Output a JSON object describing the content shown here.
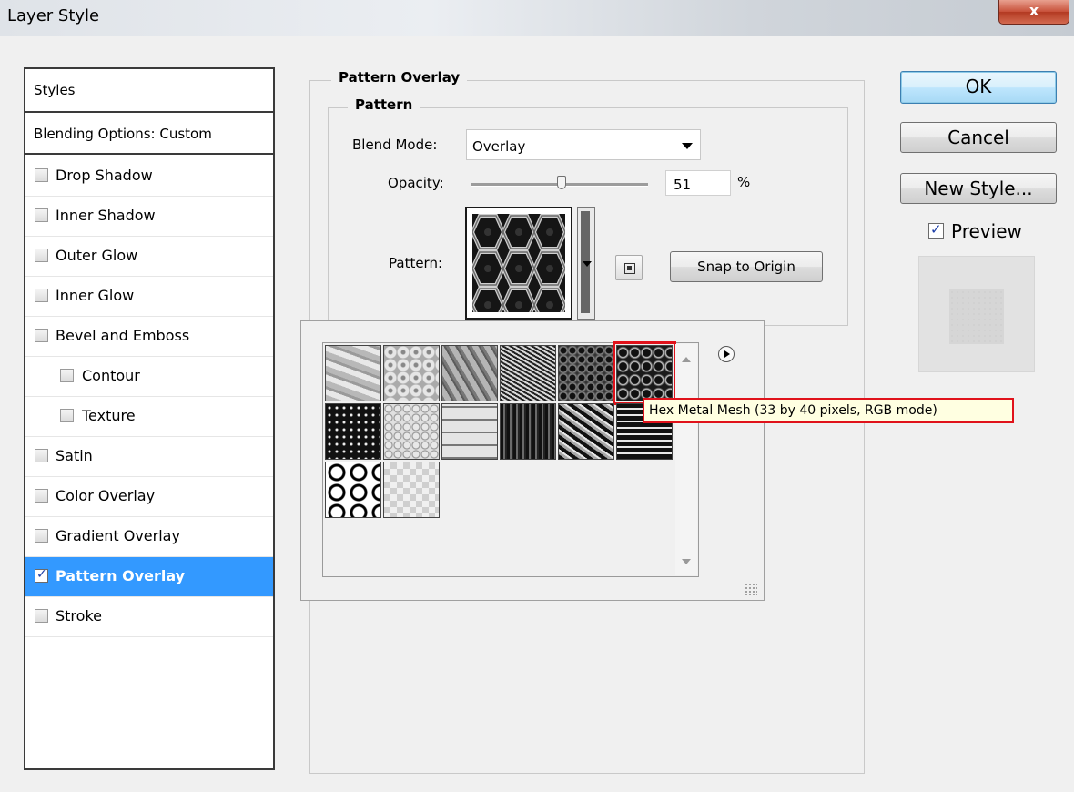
{
  "window": {
    "title": "Layer Style",
    "close_label": "x"
  },
  "styles_panel": {
    "header": "Styles",
    "blending_options": "Blending Options: Custom",
    "items": [
      {
        "label": "Drop Shadow",
        "checked": false,
        "indent": false,
        "selected": false
      },
      {
        "label": "Inner Shadow",
        "checked": false,
        "indent": false,
        "selected": false
      },
      {
        "label": "Outer Glow",
        "checked": false,
        "indent": false,
        "selected": false
      },
      {
        "label": "Inner Glow",
        "checked": false,
        "indent": false,
        "selected": false
      },
      {
        "label": "Bevel and Emboss",
        "checked": false,
        "indent": false,
        "selected": false
      },
      {
        "label": "Contour",
        "checked": false,
        "indent": true,
        "selected": false
      },
      {
        "label": "Texture",
        "checked": false,
        "indent": true,
        "selected": false
      },
      {
        "label": "Satin",
        "checked": false,
        "indent": false,
        "selected": false
      },
      {
        "label": "Color Overlay",
        "checked": false,
        "indent": false,
        "selected": false
      },
      {
        "label": "Gradient Overlay",
        "checked": false,
        "indent": false,
        "selected": false
      },
      {
        "label": "Pattern Overlay",
        "checked": true,
        "indent": false,
        "selected": true
      },
      {
        "label": "Stroke",
        "checked": false,
        "indent": false,
        "selected": false
      }
    ]
  },
  "pattern_overlay": {
    "group_title": "Pattern Overlay",
    "subgroup_title": "Pattern",
    "blend_mode_label": "Blend Mode:",
    "blend_mode_value": "Overlay",
    "opacity_label": "Opacity:",
    "opacity_value": "51",
    "opacity_unit": "%",
    "opacity_fraction": 0.51,
    "pattern_label": "Pattern:",
    "snap_button": "Snap to Origin",
    "new_preset_icon": "new-preset-icon"
  },
  "buttons": {
    "ok": "OK",
    "cancel": "Cancel",
    "new_style": "New Style..."
  },
  "preview": {
    "label": "Preview",
    "checked": true
  },
  "pattern_picker": {
    "tooltip": "Hex Metal Mesh (33 by 40 pixels, RGB mode)",
    "selected_index": 5,
    "tiles": [
      "light-marble",
      "light-swirl-mesh",
      "brushed-metal",
      "diagonal-mesh",
      "dark-hex-grid",
      "hex-metal-mesh",
      "dark-hex-weave",
      "light-hex-rings",
      "tile-blocks",
      "vertical-stripes",
      "diagonal-weave",
      "dark-blocks",
      "black-hexagons",
      "light-checker"
    ]
  },
  "colors": {
    "selection": "#3399ff",
    "highlight_red": "#e0121b",
    "tooltip_bg": "#ffffe1"
  }
}
